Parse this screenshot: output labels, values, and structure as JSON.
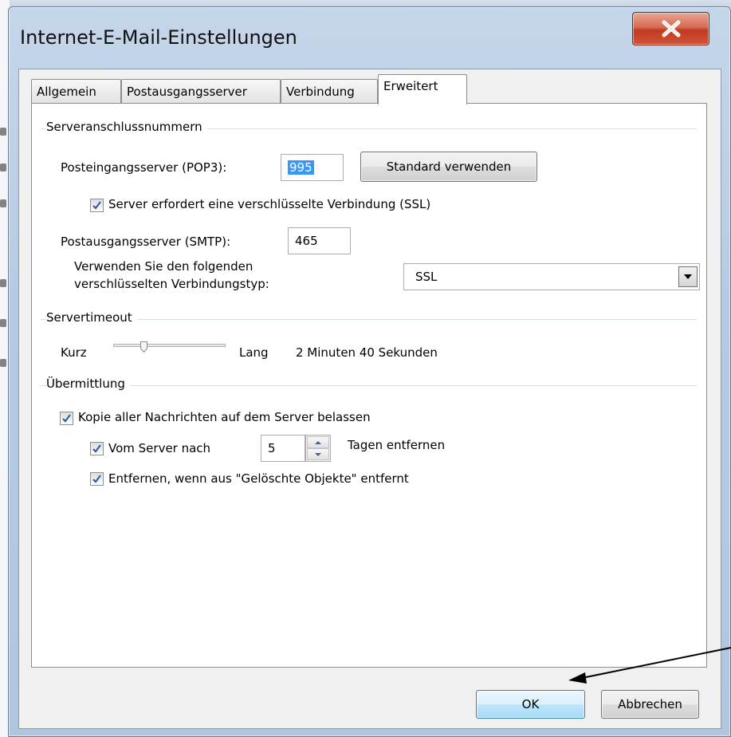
{
  "window": {
    "title": "Internet-E-Mail-Einstellungen",
    "close_symbol": "X"
  },
  "tabs": [
    {
      "label": "Allgemein",
      "active": false
    },
    {
      "label": "Postausgangsserver",
      "active": false
    },
    {
      "label": "Verbindung",
      "active": false
    },
    {
      "label": "Erweitert",
      "active": true
    }
  ],
  "ports": {
    "group_label": "Serveranschlussnummern",
    "pop3_label": "Posteingangsserver (POP3):",
    "pop3_value": "995",
    "default_button": "Standard verwenden",
    "ssl_checkbox_label": "Server erfordert eine verschlüsselte Verbindung (SSL)",
    "ssl_checked": true,
    "smtp_label": "Postausgangsserver (SMTP):",
    "smtp_value": "465",
    "encryption_label_line1": "Verwenden Sie den folgenden",
    "encryption_label_line2": "verschlüsselten Verbindungstyp:",
    "encryption_value": "SSL"
  },
  "timeout": {
    "group_label": "Servertimeout",
    "short_label": "Kurz",
    "long_label": "Lang",
    "value_text": "2 Minuten 40 Sekunden",
    "slider_position": 0.27
  },
  "delivery": {
    "group_label": "Übermittlung",
    "keep_copy_label": "Kopie aller Nachrichten auf dem Server belassen",
    "keep_copy_checked": true,
    "remove_after_label": "Vom Server nach",
    "remove_after_days": "5",
    "remove_after_suffix": "Tagen entfernen",
    "remove_after_checked": true,
    "remove_deleted_label": "Entfernen, wenn aus \"Gelöschte Objekte\" entfernt",
    "remove_deleted_checked": true
  },
  "footer": {
    "ok_label": "OK",
    "cancel_label": "Abbrechen"
  },
  "colors": {
    "selection": "#3399ff",
    "close_button": "#c8432a",
    "checkmark": "#2a5fa8"
  }
}
